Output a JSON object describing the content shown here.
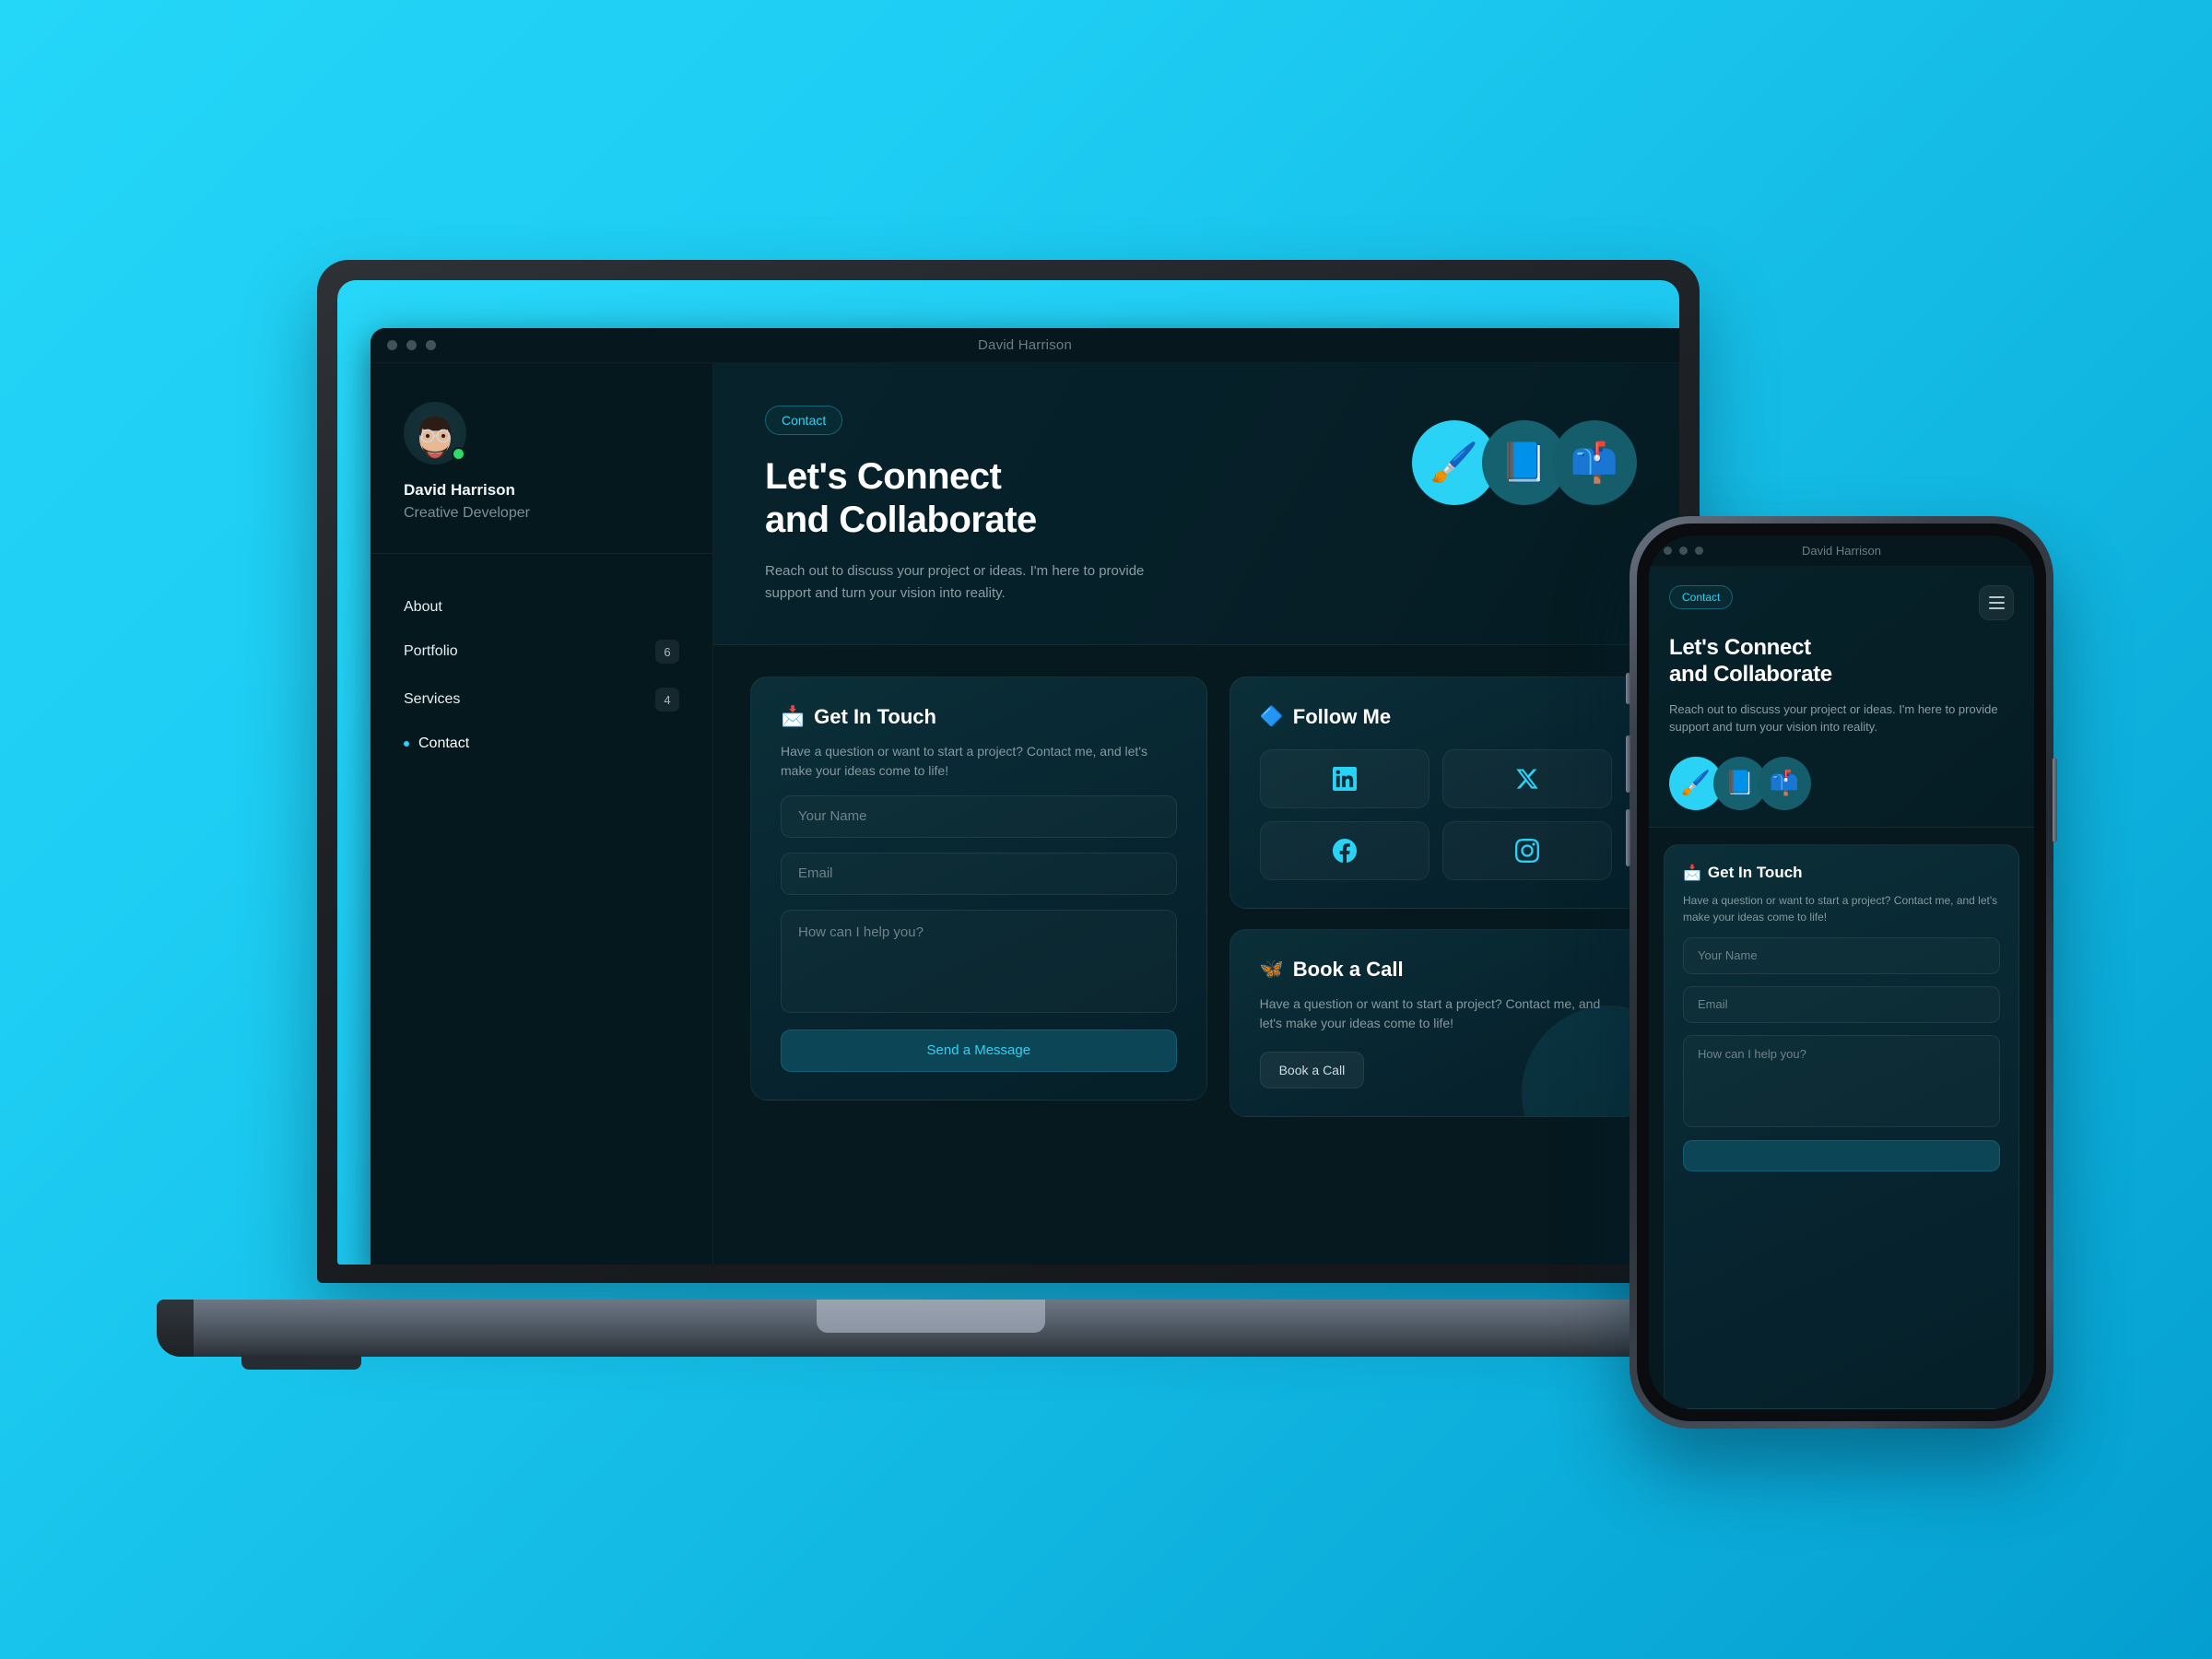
{
  "background": {
    "from": "#24d6f8",
    "to": "#049fd0"
  },
  "accent": "#2ad2f5",
  "laptop": {
    "window": {
      "title": "David Harrison"
    },
    "sidebar": {
      "profile": {
        "name": "David Harrison",
        "role": "Creative Developer",
        "status": "online"
      },
      "nav": [
        {
          "label": "About",
          "badge": "",
          "active": false
        },
        {
          "label": "Portfolio",
          "badge": "6",
          "active": false
        },
        {
          "label": "Services",
          "badge": "4",
          "active": false
        },
        {
          "label": "Contact",
          "badge": "",
          "active": true
        }
      ]
    },
    "hero": {
      "pill": "Contact",
      "title_line1": "Let's Connect",
      "title_line2": "and Collaborate",
      "subtitle": "Reach out to discuss your project or ideas. I'm here to provide support and turn your vision into reality.",
      "icons": [
        {
          "emoji": "🖌️",
          "name": "paintbrush-icon",
          "bg": "#2ad2f5"
        },
        {
          "emoji": "📘",
          "name": "blue-book-icon",
          "bg": "#16616f"
        },
        {
          "emoji": "📫",
          "name": "mailbox-icon",
          "bg": "#155d6b"
        }
      ]
    },
    "get_in_touch": {
      "emoji": "📩",
      "title": "Get In Touch",
      "desc": "Have a question or want to start a project? Contact me, and let's make your ideas come to life!",
      "name_placeholder": "Your Name",
      "email_placeholder": "Email",
      "message_placeholder": "How can I help you?",
      "submit_label": "Send a Message"
    },
    "follow_me": {
      "emoji": "🔷",
      "title": "Follow Me",
      "socials": [
        "linkedin",
        "x-twitter",
        "facebook",
        "instagram"
      ]
    },
    "book_a_call": {
      "emoji": "🦋",
      "title": "Book a Call",
      "desc": "Have a question or want to start a project? Contact me, and let's make your ideas come to life!",
      "button_label": "Book a Call"
    }
  },
  "phone": {
    "window": {
      "title": "David Harrison"
    },
    "hero": {
      "pill": "Contact",
      "title_line1": "Let's Connect",
      "title_line2": "and Collaborate",
      "subtitle": "Reach out to discuss your project or ideas. I'm here to provide support and turn your vision into reality.",
      "icons": [
        {
          "emoji": "🖌️",
          "name": "paintbrush-icon"
        },
        {
          "emoji": "📘",
          "name": "blue-book-icon"
        },
        {
          "emoji": "📫",
          "name": "mailbox-icon"
        }
      ]
    },
    "get_in_touch": {
      "emoji": "📩",
      "title": "Get In Touch",
      "desc": "Have a question or want to start a project? Contact me, and let's make your ideas come to life!",
      "name_placeholder": "Your Name",
      "email_placeholder": "Email",
      "message_placeholder": "How can I help you?"
    }
  }
}
